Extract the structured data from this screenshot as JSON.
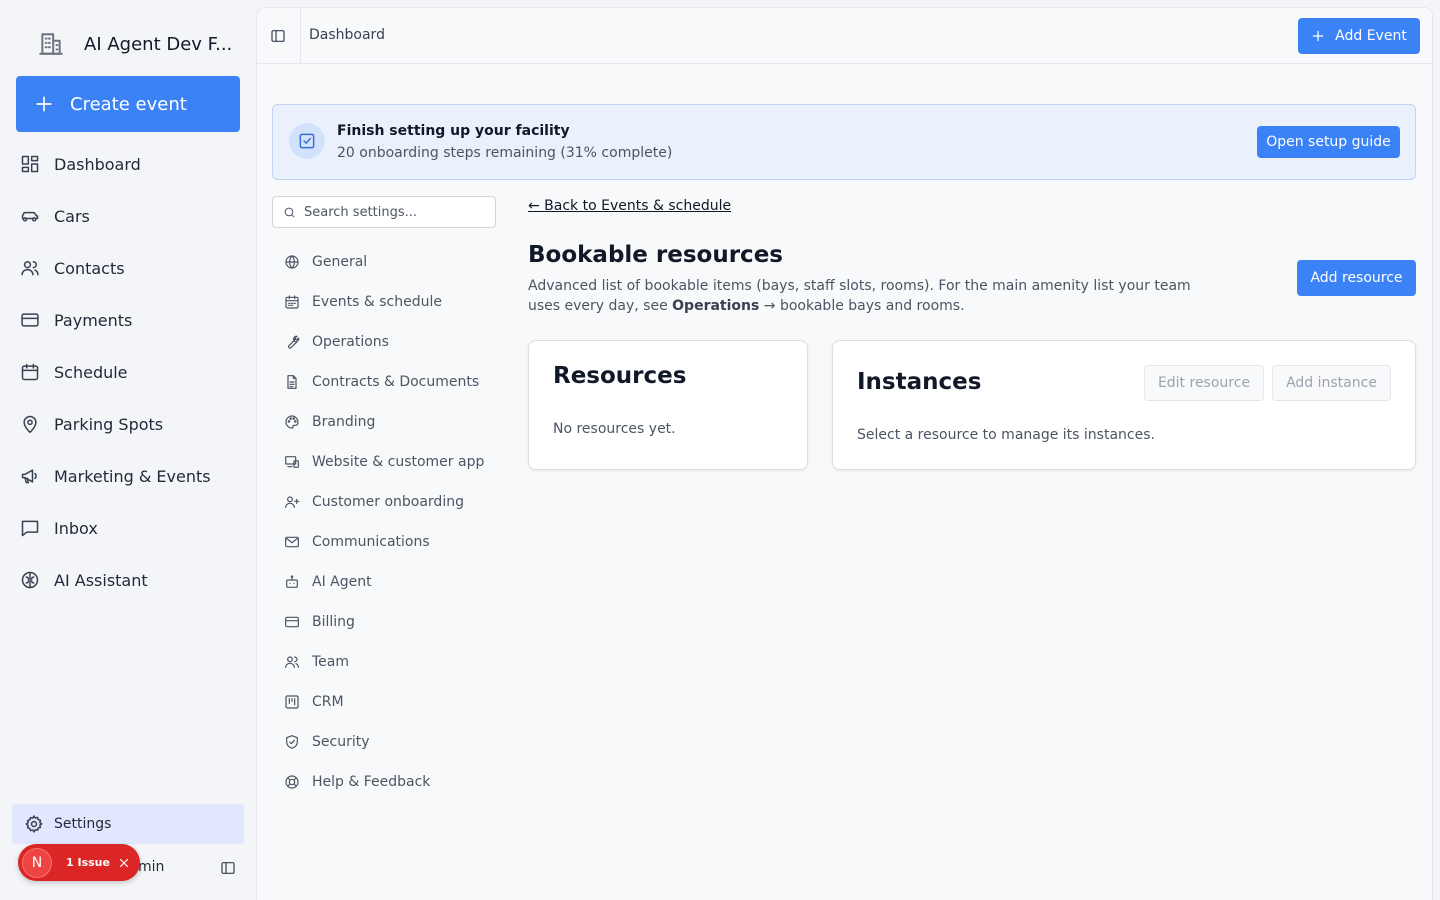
{
  "sidebar": {
    "brand_name": "AI Agent Dev F...",
    "create_label": "Create event",
    "items": [
      {
        "label": "Dashboard",
        "icon": "dashboard-icon"
      },
      {
        "label": "Cars",
        "icon": "car-icon"
      },
      {
        "label": "Contacts",
        "icon": "contacts-icon"
      },
      {
        "label": "Payments",
        "icon": "credit-card-icon"
      },
      {
        "label": "Schedule",
        "icon": "calendar-icon"
      },
      {
        "label": "Parking Spots",
        "icon": "map-pin-icon"
      },
      {
        "label": "Marketing & Events",
        "icon": "megaphone-icon"
      },
      {
        "label": "Inbox",
        "icon": "message-square-icon"
      },
      {
        "label": "AI Assistant",
        "icon": "brain-icon"
      }
    ],
    "settings_label": "Settings",
    "user_name": "min",
    "issue": {
      "avatar_letter": "N",
      "label": "1 Issue"
    }
  },
  "topbar": {
    "breadcrumb": "Dashboard",
    "add_event_label": "Add Event"
  },
  "setup": {
    "title": "Finish setting up your facility",
    "subtitle": "20 onboarding steps remaining (31% complete)",
    "button_label": "Open setup guide",
    "progress_percent": 31
  },
  "settings_nav": {
    "search_placeholder": "Search settings...",
    "items": [
      {
        "label": "General",
        "icon": "globe-icon"
      },
      {
        "label": "Events & schedule",
        "icon": "calendar-icon"
      },
      {
        "label": "Operations",
        "icon": "wrench-icon"
      },
      {
        "label": "Contracts & Documents",
        "icon": "file-text-icon"
      },
      {
        "label": "Branding",
        "icon": "palette-icon"
      },
      {
        "label": "Website & customer app",
        "icon": "devices-icon"
      },
      {
        "label": "Customer onboarding",
        "icon": "user-plus-icon"
      },
      {
        "label": "Communications",
        "icon": "mail-icon"
      },
      {
        "label": "AI Agent",
        "icon": "bot-icon"
      },
      {
        "label": "Billing",
        "icon": "credit-card-icon"
      },
      {
        "label": "Team",
        "icon": "users-icon"
      },
      {
        "label": "CRM",
        "icon": "kanban-icon"
      },
      {
        "label": "Security",
        "icon": "shield-icon"
      },
      {
        "label": "Help & Feedback",
        "icon": "life-buoy-icon"
      }
    ]
  },
  "content": {
    "back_link": "← Back to Events & schedule",
    "heading": "Bookable resources",
    "desc_prefix": "Advanced list of bookable items (bays, staff slots, rooms). For the main amenity list your team uses every day, see ",
    "desc_bold": "Operations",
    "desc_suffix": " → bookable bays and rooms.",
    "add_resource_label": "Add resource",
    "resources": {
      "title": "Resources",
      "empty": "No resources yet."
    },
    "instances": {
      "title": "Instances",
      "edit_label": "Edit resource",
      "add_label": "Add instance",
      "hint": "Select a resource to manage its instances."
    }
  },
  "colors": {
    "primary": "#3b82f6",
    "sidebar_active": "#e0e7ff",
    "banner_bg": "#eaf1fd",
    "issue_red": "#dc2626"
  }
}
